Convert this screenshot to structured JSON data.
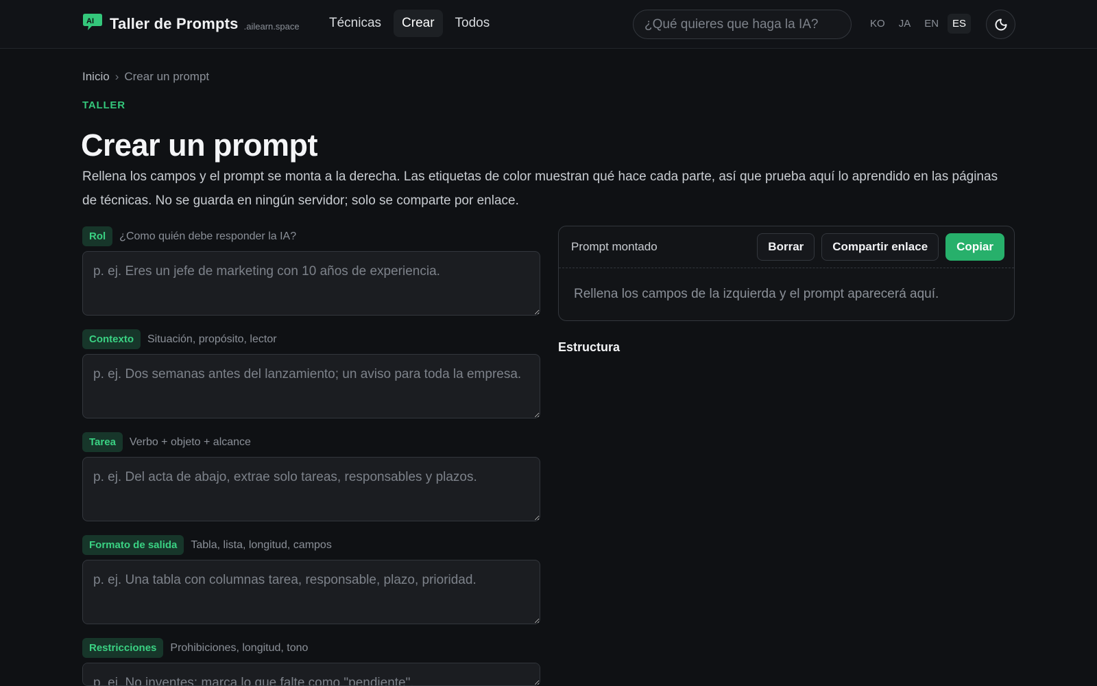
{
  "header": {
    "brand_name": "Taller de Prompts",
    "brand_domain": ".ailearn.space",
    "nav": [
      {
        "label": "Técnicas",
        "active": false
      },
      {
        "label": "Crear",
        "active": true
      },
      {
        "label": "Todos",
        "active": false
      }
    ],
    "search_placeholder": "¿Qué quieres que haga la IA?",
    "languages": [
      {
        "label": "KO",
        "active": false
      },
      {
        "label": "JA",
        "active": false
      },
      {
        "label": "EN",
        "active": false
      },
      {
        "label": "ES",
        "active": true
      }
    ],
    "theme_icon": "moon-icon"
  },
  "colors": {
    "background": "#0f1114",
    "accent_green": "#27b06b",
    "tag_text": "#3ad283",
    "tag_bg": "#17362a"
  },
  "breadcrumb": {
    "home": "Inicio",
    "separator": "›",
    "current": "Crear un prompt"
  },
  "page": {
    "eyebrow": "TALLER",
    "title": "Crear un prompt",
    "intro": "Rellena los campos y el prompt se monta a la derecha. Las etiquetas de color muestran qué hace cada parte, así que prueba aquí lo aprendido en las páginas de técnicas. No se guarda en ningún servidor; solo se comparte por enlace."
  },
  "fields": [
    {
      "tag": "Rol",
      "hint": "¿Como quién debe responder la IA?",
      "value": "",
      "placeholder": "p. ej. Eres un jefe de marketing con 10 años de experiencia."
    },
    {
      "tag": "Contexto",
      "hint": "Situación, propósito, lector",
      "value": "",
      "placeholder": "p. ej. Dos semanas antes del lanzamiento; un aviso para toda la empresa."
    },
    {
      "tag": "Tarea",
      "hint": "Verbo + objeto + alcance",
      "value": "",
      "placeholder": "p. ej. Del acta de abajo, extrae solo tareas, responsables y plazos."
    },
    {
      "tag": "Formato de salida",
      "hint": "Tabla, lista, longitud, campos",
      "value": "",
      "placeholder": "p. ej. Una tabla con columnas tarea, responsable, plazo, prioridad."
    },
    {
      "tag": "Restricciones",
      "hint": "Prohibiciones, longitud, tono",
      "value": "",
      "placeholder": "p. ej. No inventes; marca lo que falte como \"pendiente\"."
    }
  ],
  "preview": {
    "title": "Prompt montado",
    "clear_label": "Borrar",
    "share_label": "Compartir enlace",
    "copy_label": "Copiar",
    "empty_text": "Rellena los campos de la izquierda y el prompt aparecerá aquí.",
    "structure_title": "Estructura"
  }
}
